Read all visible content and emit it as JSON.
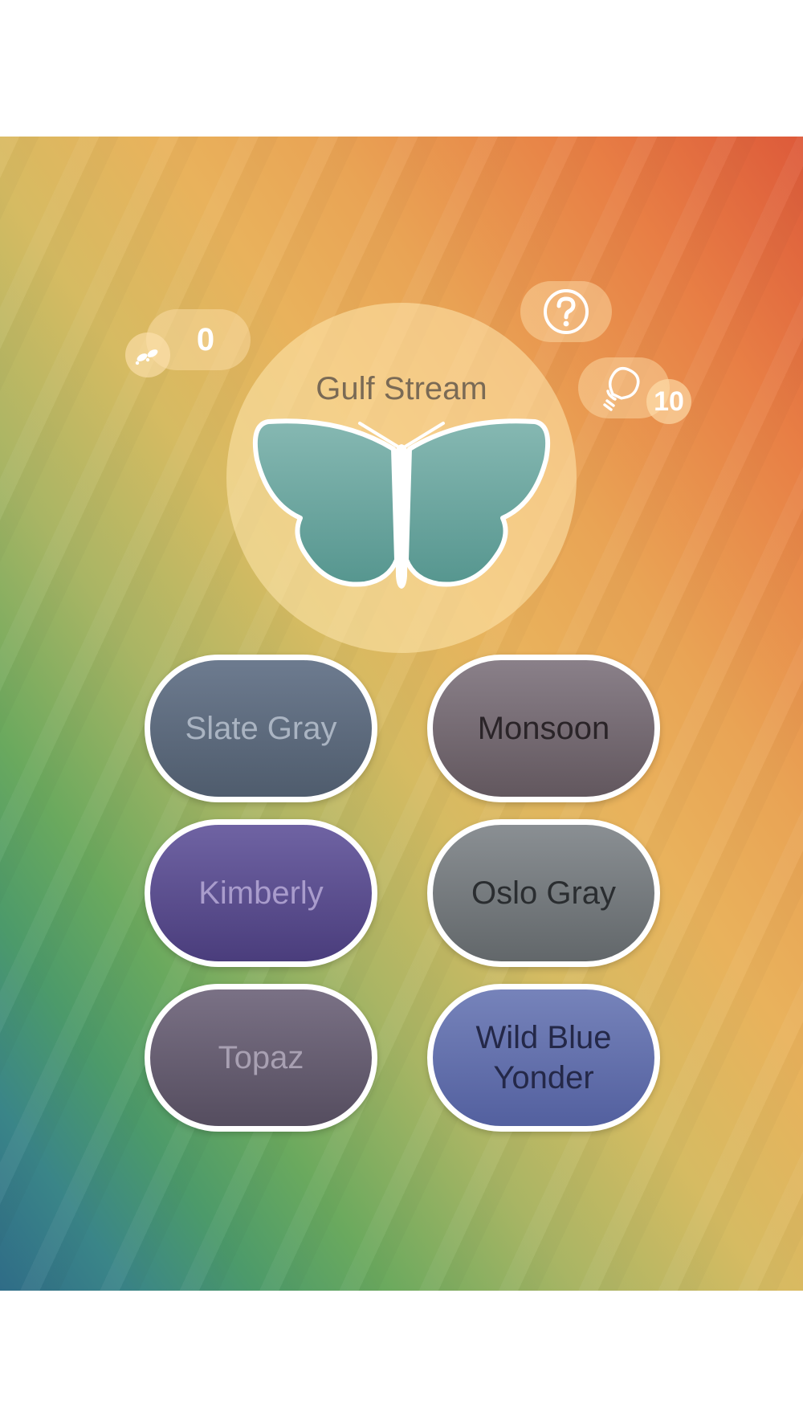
{
  "steps": {
    "count": "0",
    "icon": "footprints-icon"
  },
  "help": {
    "icon": "question-mark-icon"
  },
  "hints": {
    "icon": "lightbulb-icon",
    "count": "10"
  },
  "target": {
    "color_name": "Gulf Stream",
    "color_hex": "#74b2ab"
  },
  "options": [
    {
      "label": "Slate Gray",
      "color": "#5f6c7e"
    },
    {
      "label": "Monsoon",
      "color": "#766b74"
    },
    {
      "label": "Kimberly",
      "color": "#5e5190"
    },
    {
      "label": "Oslo Gray",
      "color": "#787c80"
    },
    {
      "label": "Topaz",
      "color": "#675f72"
    },
    {
      "label": "Wild Blue Yonder",
      "color": "#6572ad"
    }
  ]
}
